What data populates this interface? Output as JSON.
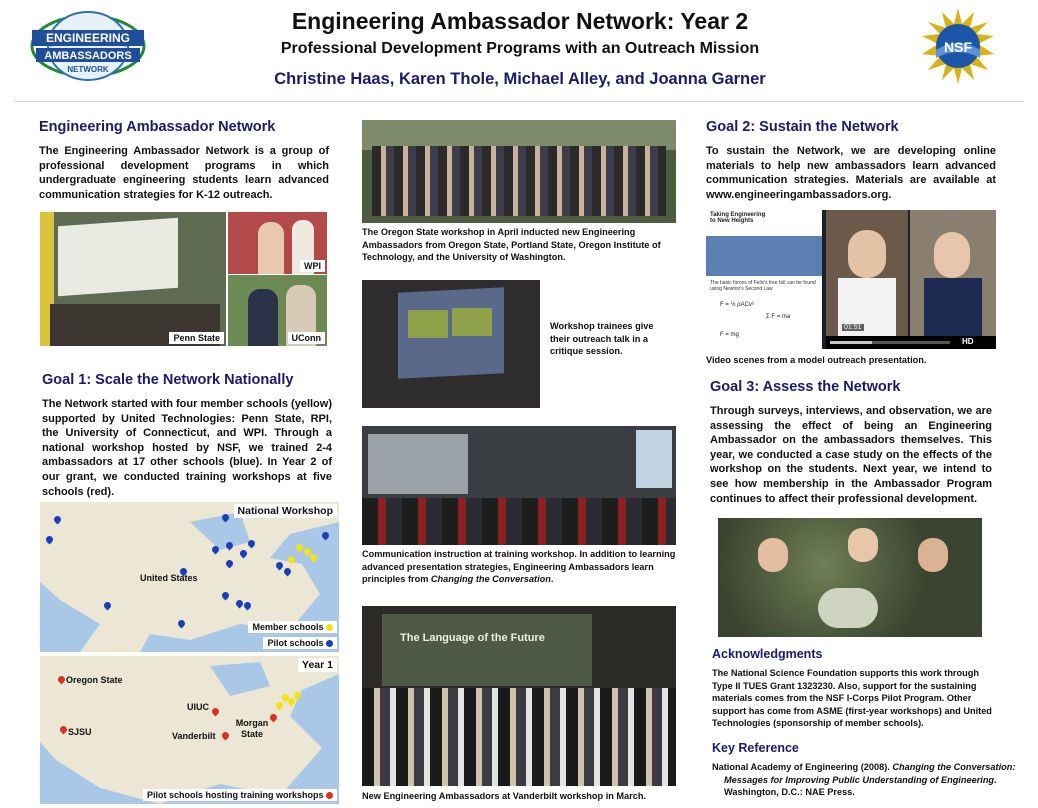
{
  "header": {
    "title": "Engineering Ambassador Network: Year 2",
    "subtitle": "Professional Development Programs with an Outreach Mission",
    "authors": "Christine Haas, Karen Thole, Michael Alley, and Joanna Garner",
    "left_logo_text": {
      "line1": "ENGINEERING",
      "line2": "AMBASSADORS",
      "line3": "NETWORK"
    },
    "right_logo_text": "NSF"
  },
  "col1": {
    "s1_heading": "Engineering Ambassador Network",
    "s1_text": "The Engineering Ambassador Network is a group of professional development programs in which undergraduate engineering students learn advanced communication strategies for K-12 outreach.",
    "photo_labels": {
      "penn_state": "Penn State",
      "wpi": "WPI",
      "uconn": "UConn"
    },
    "s2_heading": "Goal 1: Scale the Network Nationally",
    "s2_text": "The Network started with four member schools (yellow) supported by United Technologies: Penn State, RPI, the University of Connecticut, and WPI. Through a national workshop hosted by NSF, we trained 2-4 ambassadors at 17 other schools (blue). In Year 2 of our grant, we conducted training workshops at five schools (red).",
    "map1": {
      "title": "National Workshop",
      "place_label": "United States",
      "legend_member": "Member schools",
      "legend_pilot": "Pilot schools",
      "colors": {
        "member": "#f3e11a",
        "pilot": "#1b3fb8"
      }
    },
    "map2": {
      "title": "Year 1",
      "labels": [
        "Oregon State",
        "SJSU",
        "UIUC",
        "Vanderbilt",
        "Morgan State"
      ],
      "legend": "Pilot schools hosting training workshops",
      "colors": {
        "host": "#d8322a"
      }
    }
  },
  "col2": {
    "cap1": "The Oregon State workshop in April inducted new Engineering Ambassadors from  Oregon State, Portland State, Oregon Institute of Technology, and the University of Washington.",
    "cap2": "Workshop trainees give their outreach talk in a critique session.",
    "cap3_prefix": "Communication instruction at training workshop. In addition to learning advanced presentation strategies, Engineering Ambassadors learn principles from ",
    "cap3_italic": "Changing the Conversation",
    "cap3_suffix": ".",
    "slide_title": "The Language of the Future",
    "cap4": "New Engineering Ambassadors at Vanderbilt workshop in March."
  },
  "col3": {
    "g2_heading": "Goal 2: Sustain the Network",
    "g2_text": "To sustain the Network, we are developing online materials to help new ambassadors learn advanced communication strategies. Materials are available at www.engineeringambassadors.org.",
    "video": {
      "slide_title": "Taking Engineering to New Heights",
      "slide_text": "The basic forces of Felix's free fall can be found using Newton's Second Law",
      "eq1": "F = ½ ρACv²",
      "eq2": "Σ F = ma",
      "eq3": "F = mg",
      "time": "01:51",
      "hd": "HD"
    },
    "video_cap": "Video scenes from a model outreach presentation.",
    "g3_heading": "Goal 3: Assess the Network",
    "g3_text": "Through surveys, interviews, and observation, we are assessing the effect of being an Engineering Ambassador on the ambassadors themselves. This year, we conducted a case study on the effects of the workshop on the students. Next year, we intend to see how membership in the Ambassador Program continues to affect their professional development.",
    "ack_heading": "Acknowledgments",
    "ack_text": "The National Science Foundation supports this work through Type II TUES Grant 1323230. Also, support for the sustaining materials comes from the NSF I-Corps Pilot Program. Other support has come from ASME (first-year workshops) and United Technologies (sponsorship of member schools).",
    "ref_heading": "Key Reference",
    "ref_prefix": "National Academy of Engineering (2008). ",
    "ref_italic": "Changing the Conversation: Messages for Improving Public Understanding of Engineering",
    "ref_suffix": ". Washington, D.C.: NAE Press."
  }
}
